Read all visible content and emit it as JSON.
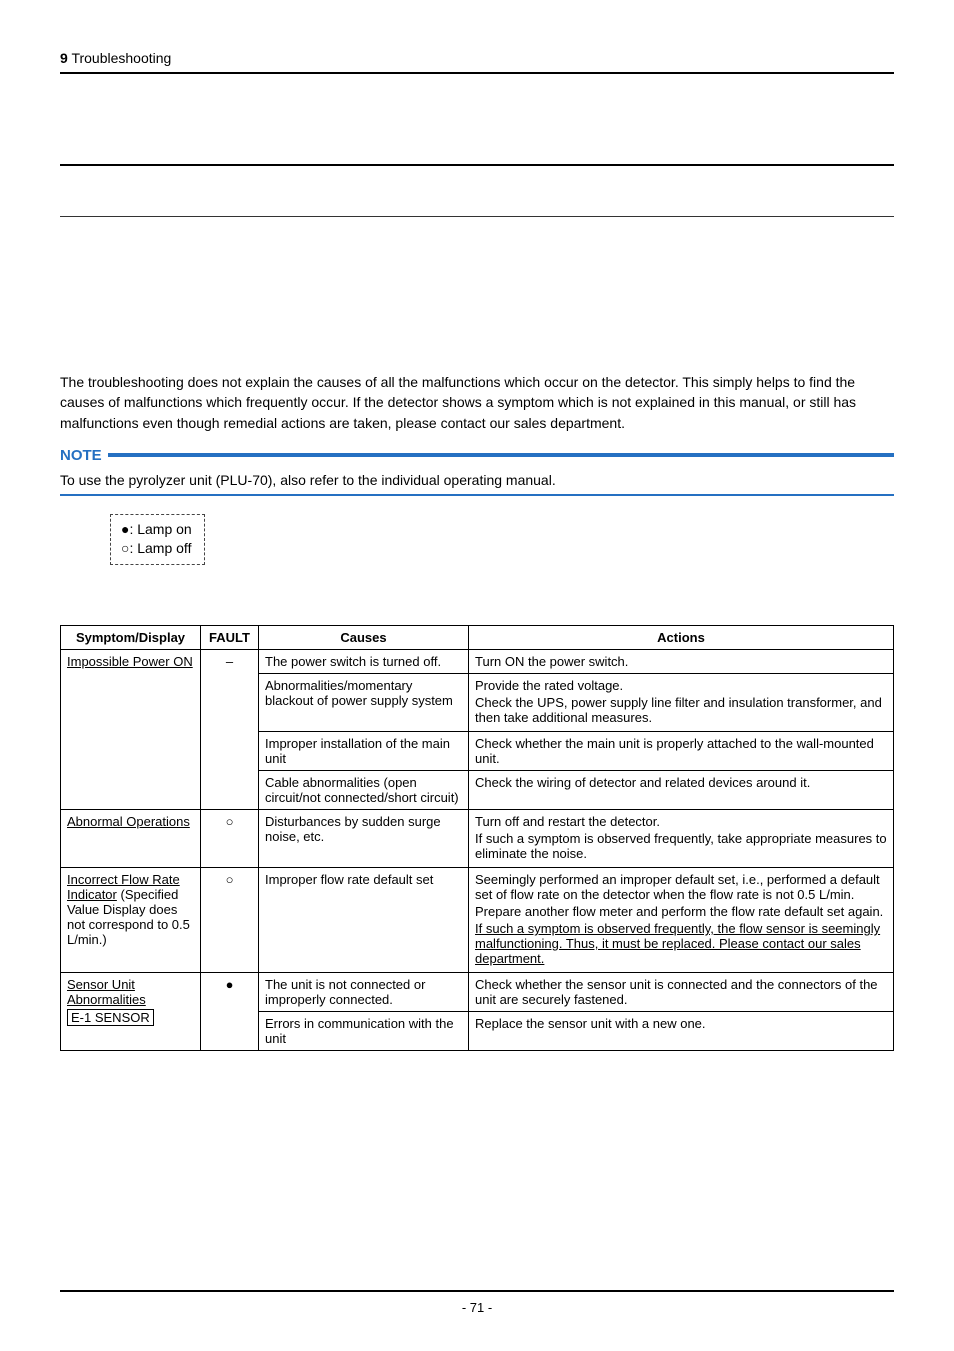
{
  "header": {
    "section_num": "9",
    "section_title": "Troubleshooting"
  },
  "intro": "The troubleshooting does not explain the causes of all the malfunctions which occur on the detector. This simply helps to find the causes of malfunctions which frequently occur. If the detector shows a symptom which is not explained in this manual, or still has malfunctions even though remedial actions are taken, please contact our sales department.",
  "note": {
    "label": "NOTE",
    "text": "To use the pyrolyzer unit (PLU-70), also refer to the individual operating manual."
  },
  "legend": {
    "on": "●: Lamp on",
    "off": "○: Lamp off"
  },
  "table": {
    "headers": {
      "sym": "Symptom/Display",
      "fault": "FAULT",
      "cause": "Causes",
      "act": "Actions"
    },
    "r1": {
      "sym": "Impossible Power ON",
      "fault": "–",
      "c1": "The power switch is turned off.",
      "a1": "Turn ON the power switch.",
      "c2": "Abnormalities/momentary blackout of power supply system",
      "a2a": "Provide the rated voltage.",
      "a2b": "Check the UPS, power supply line filter and insulation transformer, and then take additional measures.",
      "c3": "Improper installation of the main unit",
      "a3": "Check whether the main unit is properly attached to the wall-mounted unit.",
      "c4": "Cable abnormalities (open circuit/not connected/short circuit)",
      "a4": "Check the wiring of detector and related devices around it."
    },
    "r2": {
      "sym": "Abnormal Operations",
      "fault": "○",
      "c1": "Disturbances by sudden surge noise, etc.",
      "a1a": "Turn off and restart the detector.",
      "a1b": "If such a symptom is observed frequently, take appropriate measures to eliminate the noise."
    },
    "r3": {
      "sym_a": "Incorrect Flow Rate Indicator",
      "sym_b": " (Specified Value Display does not correspond to 0.5 L/min.)",
      "fault": "○",
      "c1": "Improper flow rate default set",
      "a1a": "Seemingly performed an improper default set, i.e., performed a default set of flow rate on the detector when the flow rate is not 0.5 L/min.",
      "a1b": "Prepare another flow meter and perform the flow rate default set again.",
      "a1c": "If such a symptom is observed frequently, the flow sensor is seemingly malfunctioning. Thus, it must be replaced. Please contact our sales department."
    },
    "r4": {
      "sym": "Sensor Unit Abnormalities",
      "box": "E-1 SENSOR",
      "fault": "●",
      "c1": "The unit is not connected or improperly connected.",
      "a1": "Check whether the sensor unit is connected and the connectors of the unit are securely fastened.",
      "c2": "Errors in communication with the unit",
      "a2": "Replace the sensor unit with a new one."
    }
  },
  "footer": {
    "page": "- 71 -"
  }
}
